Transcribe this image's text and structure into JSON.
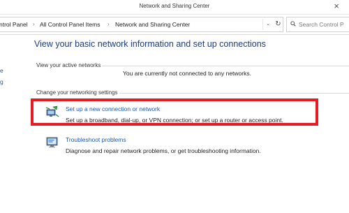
{
  "window": {
    "title": "Network and Sharing Center",
    "close_glyph": "×"
  },
  "address_bar": {
    "breadcrumb": [
      "ntrol Panel",
      "All Control Panel Items",
      "Network and Sharing Center"
    ],
    "separator": "›",
    "dropdown_glyph": "⌄",
    "refresh_glyph": "↻",
    "search_placeholder": "Search Control P"
  },
  "left_pane": {
    "fragments": [
      "e",
      "g"
    ]
  },
  "main": {
    "title": "View your basic network information and set up connections",
    "active_networks": {
      "label": "View your active networks",
      "status": "You are currently not connected to any networks."
    },
    "settings": {
      "label": "Change your networking settings",
      "tasks": [
        {
          "link": "Set up a new connection or network",
          "description": "Set up a broadband, dial-up, or VPN connection; or set up a router or access point.",
          "icon": "network-setup-icon"
        },
        {
          "link": "Troubleshoot problems",
          "description": "Diagnose and repair network problems, or get troubleshooting information.",
          "icon": "troubleshoot-icon"
        }
      ]
    }
  },
  "colors": {
    "highlight": "#e51c23",
    "link": "#1a56b8",
    "title": "#1e3c7c"
  }
}
